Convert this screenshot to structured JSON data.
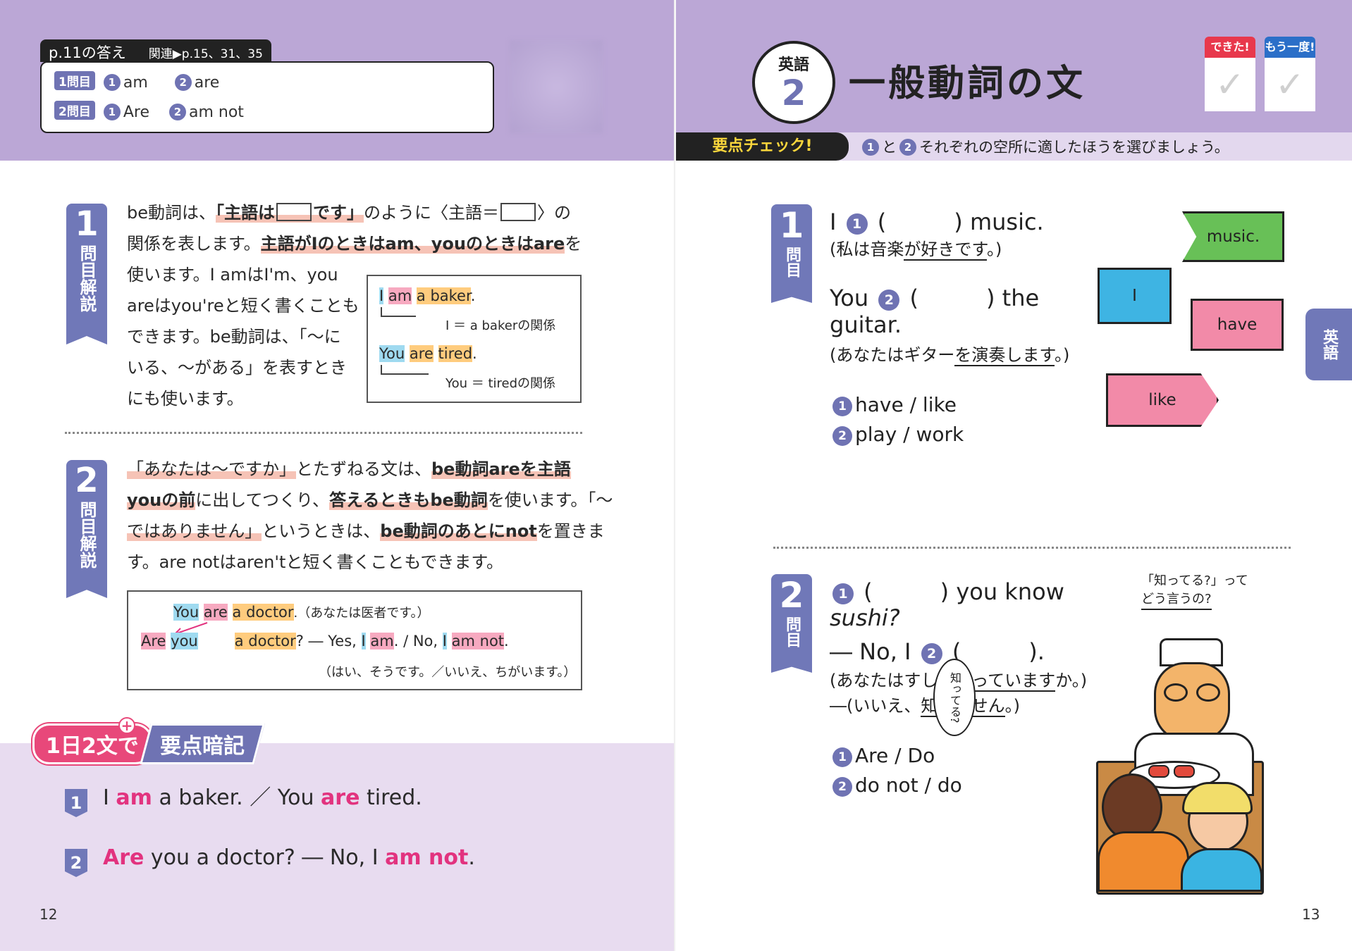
{
  "left": {
    "answers": {
      "tab": "p.11の答え",
      "related": "関連▶p.15、31、35",
      "rows": [
        {
          "tag": "1問目",
          "n1": "1",
          "a1": "am",
          "n2": "2",
          "a2": "are"
        },
        {
          "tag": "2問目",
          "n1": "1",
          "a1": "Are",
          "n2": "2",
          "a2": "am not"
        }
      ]
    },
    "section1": {
      "num": "1",
      "label": "問目解説",
      "text": {
        "a": "be動詞は、",
        "b": "「主語は",
        "c": "です」",
        "d": "のように〈主語＝",
        "e": "〉の",
        "f": "関係を表します。",
        "g": "主語がIのときはam、youのときはare",
        "h": "を",
        "i": "使います。I amはI'm、you",
        "j": "areはyou'reと短く書くことも",
        "k": "できます。be動詞は、「～に",
        "l": "いる、～がある」を表すとき",
        "m": "にも使います。"
      },
      "example": {
        "s1": {
          "w1": "I",
          "w2": "am",
          "w3": "a baker",
          "end": ".",
          "rel": "I ＝ a bakerの関係"
        },
        "s2": {
          "w1": "You",
          "w2": "are",
          "w3": "tired",
          "end": ".",
          "rel": "You ＝ tiredの関係"
        }
      }
    },
    "section2": {
      "num": "2",
      "label": "問目解説",
      "text": {
        "a": "「あなたは～ですか」",
        "b": "とたずねる文は、",
        "c": "be動詞areを主語",
        "d": "youの前",
        "e": "に出してつくり、",
        "f": "答えるときもbe動詞",
        "g": "を使います。「～",
        "h": "ではありません」",
        "i": "というときは、",
        "j": "be動詞のあとにnot",
        "k": "を置きま",
        "l": "す。are notはaren'tと短く書くこともできます。"
      },
      "example": {
        "l1": {
          "w1": "You",
          "w2": "are",
          "w3": "a doctor",
          "tail": ".（あなたは医者です。）"
        },
        "l2": {
          "w1": "Are",
          "w2": "you",
          "w3": "a doctor",
          "tail": "? ― Yes,",
          "w4": "I",
          "w5": "am",
          "tail2": ". / No,",
          "w6": "I",
          "w7": "am not",
          "end": "."
        },
        "l3": "（はい、そうです。／いいえ、ちがいます。）"
      },
      "separator": "……"
    },
    "memo": {
      "badge1": "1日2文で",
      "plus": "+",
      "badge2": "要点暗記",
      "line1": {
        "n": "1",
        "a": "I",
        "b": "am",
        "c": "a baker. ／ You",
        "d": "are",
        "e": "tired."
      },
      "line2": {
        "n": "2",
        "a": "Are",
        "b": "you a doctor? ― No, I",
        "c": "am not",
        "d": "."
      }
    },
    "page_no": "12"
  },
  "right": {
    "subject": "英語",
    "lesson": "2",
    "title": "一般動詞の文",
    "checks": {
      "done": "できた!",
      "again": "もう一度!",
      "mark": "✓"
    },
    "strip": {
      "label": "要点チェック!",
      "n1": "1",
      "to": "と",
      "n2": "2",
      "text": "それぞれの空所に適したほうを選びましょう。"
    },
    "q1": {
      "num": "1",
      "label": "問目",
      "s1": {
        "a": "I",
        "n": "1",
        "blank": "(　　　)",
        "b": "music."
      },
      "t1": {
        "a": "(私は音楽",
        "b": "が好きです",
        "c": "。)"
      },
      "s2": {
        "a": "You",
        "n": "2",
        "blank": "(　　　)",
        "b": "the"
      },
      "s2b": "guitar.",
      "t2": {
        "a": "(あなたはギター",
        "b": "を演奏します",
        "c": "。)"
      },
      "c1": {
        "n": "1",
        "text": "have / like"
      },
      "c2": {
        "n": "2",
        "text": "play / work"
      },
      "pieces": {
        "music": "music.",
        "i": "I",
        "have": "have",
        "like": "like"
      }
    },
    "q2": {
      "num": "2",
      "label": "問目",
      "s1": {
        "n": "1",
        "blank": "(　　　)",
        "b": "you know"
      },
      "s1b": "sushi?",
      "s2": {
        "a": "― No, I",
        "n": "2",
        "blank": "(　　　)",
        "b": "."
      },
      "t1": {
        "a": "(あなたはすし",
        "b": "を知っています",
        "c": "か。)"
      },
      "t2": {
        "a": "―(いいえ、",
        "b": "知りません",
        "c": "。)"
      },
      "c1": {
        "n": "1",
        "text": "Are / Do"
      },
      "c2": {
        "n": "2",
        "text": "do not / do"
      },
      "caption": {
        "l1": "「知ってる?」って",
        "l2": "どう言うの?"
      },
      "bubble": "知ってる?"
    },
    "side_tab": "英語",
    "page_no": "13"
  },
  "colors": {
    "purple_band": "#bba7d6",
    "navy": "#6f73b3",
    "pink": "#e2337f",
    "orange_hl": "#ffcc7e",
    "blue_hl": "#9fdaf0",
    "pink_hl": "#f7a9c0"
  }
}
